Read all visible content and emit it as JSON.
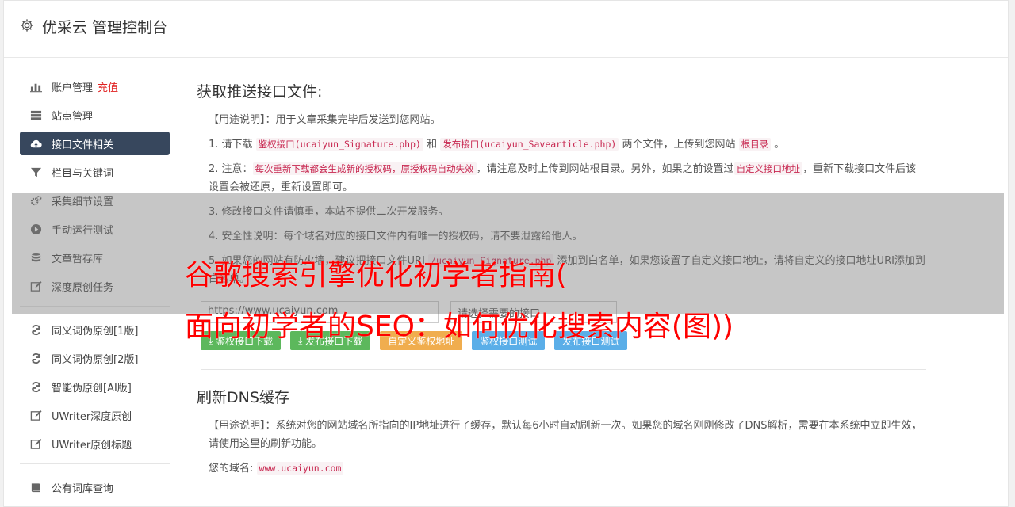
{
  "header": {
    "title": "优采云 管理控制台"
  },
  "sidebar": {
    "items": [
      {
        "label": "账户管理",
        "extra": "充值",
        "icon": "bar-chart-icon"
      },
      {
        "label": "站点管理",
        "icon": "server-icon"
      },
      {
        "label": "接口文件相关",
        "icon": "cloud-upload-icon",
        "active": true
      },
      {
        "label": "栏目与关键词",
        "icon": "filter-icon"
      },
      {
        "label": "采集细节设置",
        "icon": "cogs-icon"
      },
      {
        "label": "手动运行测试",
        "icon": "play-icon"
      },
      {
        "label": "文章暂存库",
        "icon": "database-icon"
      },
      {
        "label": "深度原创任务",
        "icon": "edit-icon"
      },
      {
        "label": "同义词伪原创[1版]",
        "icon": "refresh-icon"
      },
      {
        "label": "同义词伪原创[2版]",
        "icon": "refresh-icon"
      },
      {
        "label": "智能伪原创[AI版]",
        "icon": "refresh-icon"
      },
      {
        "label": "UWriter深度原创",
        "icon": "edit-icon"
      },
      {
        "label": "UWriter原创标题",
        "icon": "edit-icon"
      },
      {
        "label": "公有词库查询",
        "icon": "book-icon"
      }
    ]
  },
  "section1": {
    "title": "获取推送接口文件:",
    "usage_label": "【用途说明】",
    "usage_text": "：用于文章采集完毕后发送到您网站。",
    "p1_a": "1. 请下载",
    "p1_code1": "鉴权接口(ucaiyun_Signature.php)",
    "p1_b": "和",
    "p1_code2": "发布接口(ucaiyun_Savearticle.php)",
    "p1_c": "两个文件，上传到您网站",
    "p1_code3": "根目录",
    "p1_d": "。",
    "p2_a": "2. 注意：",
    "p2_code1": "每次重新下载都会生成新的授权码，原授权码自动失效",
    "p2_b": "，请注意及时上传到网站根目录。另外，如果之前设置过",
    "p2_code2": "自定义接口地址",
    "p2_c": "，重新下载接口文件后该设置会被还原，重新设置即可。",
    "p3": "3. 修改接口文件请慎重，本站不提供二次开发服务。",
    "p4": "4. 安全性说明：每个域名对应的接口文件内有唯一的授权码，请不要泄露给他人。",
    "p5_a": "5. 如果您的网站",
    "p5_b": "有防火墙，建议把接口文件URI",
    "p5_code": "/ucaiyun_Signature.php",
    "p5_c": "添加到白名单，如果您设置了自定义接口地址，请将自定义的接口地址URI添加到白名单。",
    "url_value": "https://www.ucaiyun.com",
    "select_placeholder": "请选择需要的接口",
    "buttons": {
      "sig_download": "鉴权接口下载",
      "pub_download": "发布接口下载",
      "custom": "自定义鉴权地址",
      "sig_test": "鉴权接口测试",
      "pub_test": "发布接口测试"
    }
  },
  "section2": {
    "title": "刷新DNS缓存",
    "usage_label": "【用途说明】",
    "usage_text": "：系统对您的网站域名所指向的IP地址进行了缓存，默认每6小时自动刷新一次。如果您的域名刚刚修改了DNS解析，需要在本系统中立即生效，请使用这里的刷新功能。",
    "domain_label": "您的域名:",
    "domain_value": "www.ucaiyun.com"
  },
  "watermark": {
    "line1": "谷歌搜索引擎优化初学者指南(",
    "line2": "面向初学者的SEO：如何优化搜索内容(图))"
  },
  "colors": {
    "active_nav": "#37475d",
    "watermark": "#ff0000",
    "green": "#5cb85c",
    "orange": "#f0ad4e",
    "blue": "#5aaee8"
  }
}
